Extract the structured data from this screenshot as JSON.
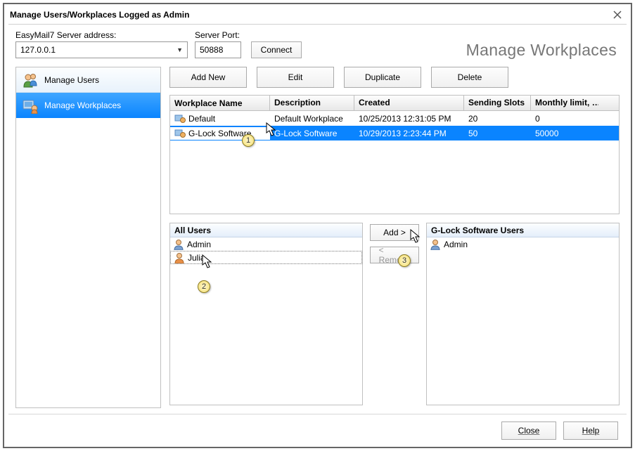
{
  "window": {
    "title": "Manage Users/Workplaces Logged as Admin",
    "heading": "Manage Workplaces"
  },
  "form": {
    "server_label": "EasyMail7 Server address:",
    "server_value": "127.0.0.1",
    "port_label": "Server Port:",
    "port_value": "50888",
    "connect_label": "Connect"
  },
  "sidebar": {
    "items": [
      {
        "label": "Manage Users",
        "selected": false
      },
      {
        "label": "Manage Workplaces",
        "selected": true
      }
    ]
  },
  "toolbar": {
    "add_new": "Add New",
    "edit": "Edit",
    "duplicate": "Duplicate",
    "delete": "Delete"
  },
  "grid": {
    "headers": {
      "name": "Workplace Name",
      "desc": "Description",
      "created": "Created",
      "slots": "Sending Slots",
      "limit": "Monthly limit, …"
    },
    "rows": [
      {
        "name": "Default",
        "desc": "Default Workplace",
        "created": "10/25/2013 12:31:05 PM",
        "slots": "20",
        "limit": "0",
        "selected": false
      },
      {
        "name": "G-Lock Software",
        "desc": "G-Lock Software",
        "created": "10/29/2013 2:23:44 PM",
        "slots": "50",
        "limit": "50000",
        "selected": true
      }
    ]
  },
  "lower": {
    "all_users_header": "All Users",
    "all_users": [
      "Admin",
      "Julia"
    ],
    "add_label": "Add >",
    "remove_label": "< Remove",
    "group_header": "G-Lock Software Users",
    "group_users": [
      "Admin"
    ]
  },
  "footer": {
    "close": "Close",
    "help": "Help"
  },
  "callouts": [
    "1",
    "2",
    "3"
  ]
}
